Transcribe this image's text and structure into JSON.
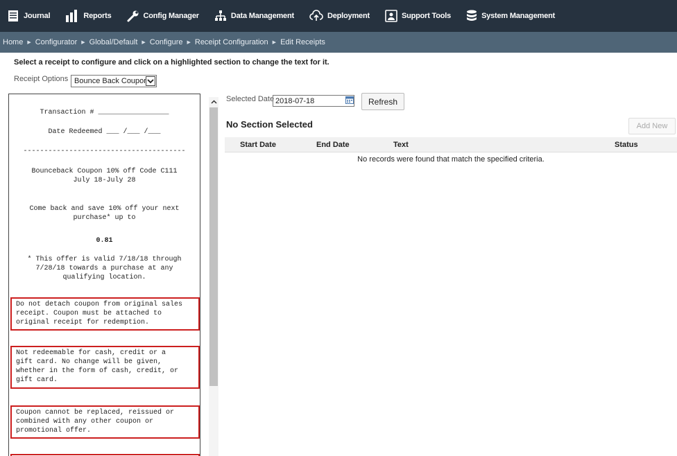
{
  "nav": {
    "items": [
      {
        "label": "Journal",
        "icon": "journal-icon"
      },
      {
        "label": "Reports",
        "icon": "bar-chart-icon"
      },
      {
        "label": "Config Manager",
        "icon": "wrench-icon"
      },
      {
        "label": "Data Management",
        "icon": "hierarchy-icon"
      },
      {
        "label": "Deployment",
        "icon": "cloud-upload-icon"
      },
      {
        "label": "Support Tools",
        "icon": "support-icon"
      },
      {
        "label": "System Management",
        "icon": "database-icon"
      }
    ]
  },
  "breadcrumb": [
    "Home",
    "Configurator",
    "Global/Default",
    "Configure",
    "Receipt Configuration",
    "Edit Receipts"
  ],
  "instructions": "Select a receipt to configure and click on a highlighted section to change the text for it.",
  "receipt_options": {
    "label": "Receipt Options",
    "value": "Bounce Back Coupon"
  },
  "receipt": {
    "transaction": "Transaction # _________________",
    "date_redeemed": "Date Redeemed ___ /___ /___",
    "divider": "---------------------------------------",
    "coupon_title": "Bounceback Coupon 10% off Code C111\nJuly 18-July 28",
    "come_back": "Come back and save 10% off your next\npurchase* up to",
    "amount": "0.81",
    "validity": "* This offer is valid 7/18/18 through\n7/28/18 towards a purchase at any\nqualifying location.",
    "sections": [
      "Do not detach coupon from original sales\nreceipt. Coupon must be attached to\noriginal receipt for redemption.",
      "Not redeemable for cash, credit or a\ngift card. No change will be given,\nwhether in the form of cash, credit, or\ngift card.",
      "Coupon cannot be replaced, reissued or\ncombined with any other coupon or\npromotional offer.",
      ""
    ]
  },
  "right": {
    "date_label": "Selected Date",
    "date_value": "2018-07-18",
    "refresh_label": "Refresh",
    "section_title": "No Section Selected",
    "add_label": "Add New",
    "columns": [
      "Start Date",
      "End Date",
      "Text",
      "Status"
    ],
    "empty_message": "No records were found that match the specified criteria."
  },
  "colors": {
    "nav_bg": "#26323f",
    "breadcrumb_bg": "#4f6577",
    "highlight": "#cc1f1f"
  }
}
